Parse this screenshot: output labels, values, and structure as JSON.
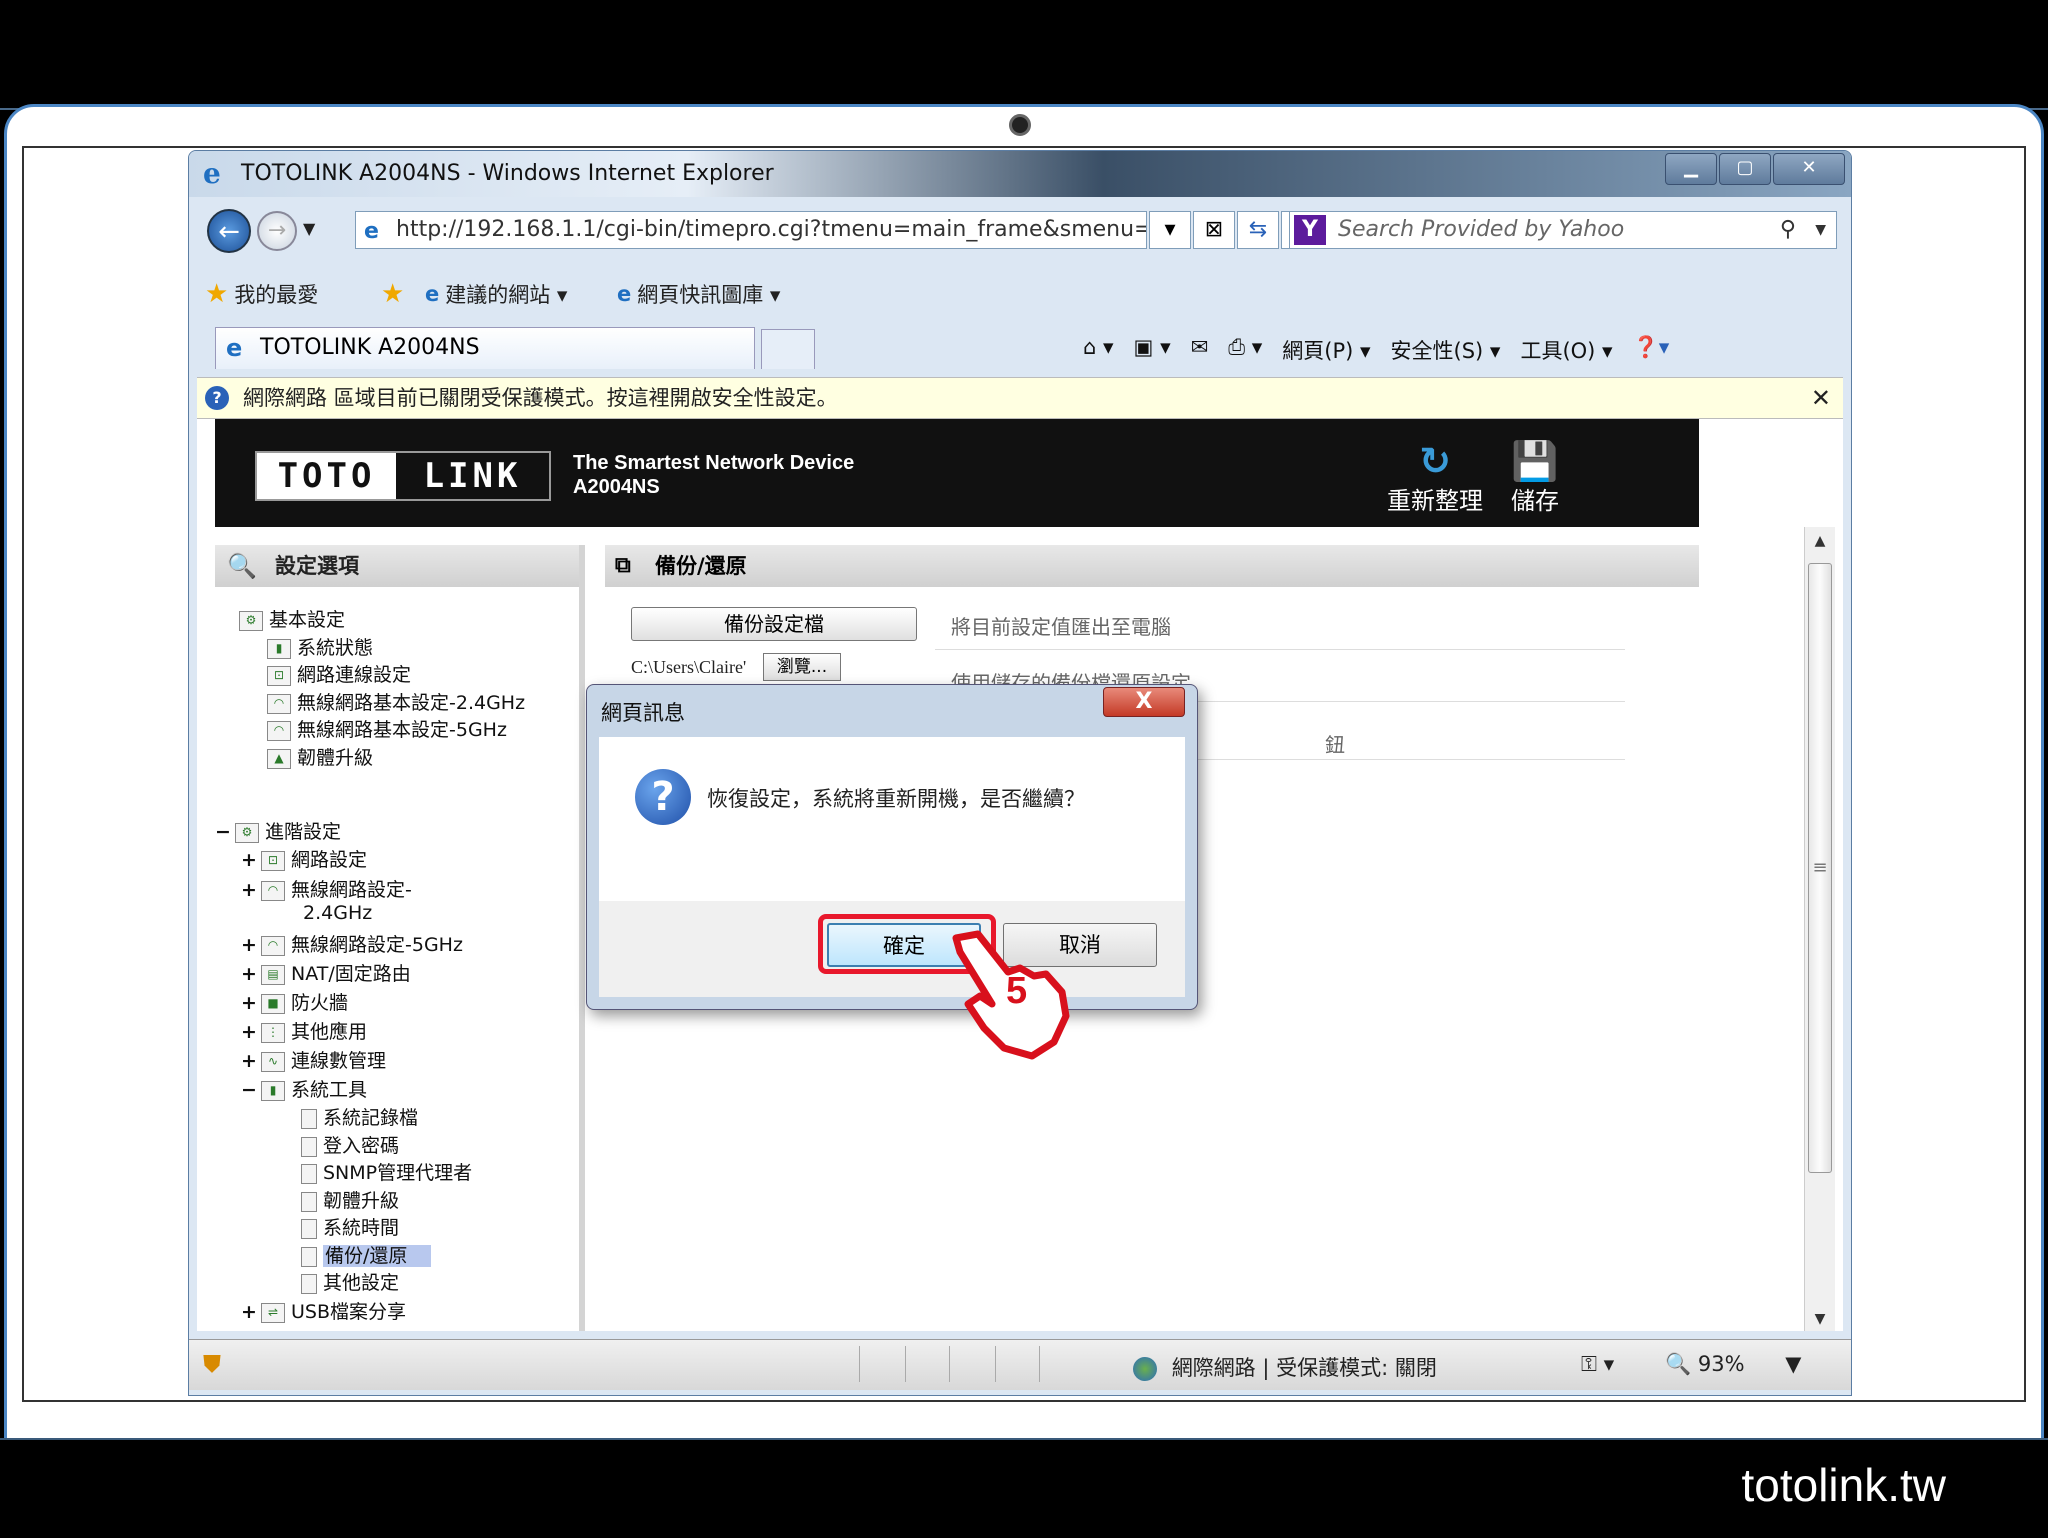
{
  "browser": {
    "title": "TOTOLINK A2004NS - Windows Internet Explorer",
    "address": "http://192.168.1.1/cgi-bin/timepro.cgi?tmenu=main_frame&smenu=",
    "search_placeholder": "Search Provided by Yahoo",
    "favorites": "我的最愛",
    "suggested_sites": "建議的網站 ▾",
    "web_slice_gallery": "網頁快訊圖庫 ▾",
    "tab_title": "TOTOLINK A2004NS",
    "commands": [
      "網頁(P) ▾",
      "安全性(S) ▾",
      "工具(O) ▾"
    ],
    "info_bar": "網際網路 區域目前已關閉受保護模式。按這裡開啟安全性設定。",
    "status_zone": "網際網路 | 受保護模式: 關閉",
    "zoom": "93%"
  },
  "router": {
    "logo_left": "TOTO",
    "logo_right": "LINK",
    "tagline1": "The Smartest Network Device",
    "tagline2": "A2004NS",
    "refresh_label": "重新整理",
    "save_label": "儲存"
  },
  "sidebar": {
    "title": "設定選項",
    "basic": {
      "label": "基本設定",
      "items": [
        "系統狀態",
        "網路連線設定",
        "無線網路基本設定-2.4GHz",
        "無線網路基本設定-5GHz",
        "韌體升級"
      ]
    },
    "advanced": {
      "label": "進階設定",
      "items": [
        "網路設定",
        "無線網路設定-",
        "2.4GHz",
        "無線網路設定-5GHz",
        "NAT/固定路由",
        "防火牆",
        "其他應用",
        "連線數管理",
        "系統工具"
      ]
    },
    "tools": [
      "系統記錄檔",
      "登入密碼",
      "SNMP管理代理者",
      "韌體升級",
      "系統時間",
      "備份/還原",
      "其他設定"
    ],
    "usb": "USB檔案分享"
  },
  "main": {
    "title": "備份/還原",
    "backup_button": "備份設定檔",
    "backup_desc": "將目前設定值匯出至電腦",
    "file_path": "C:\\Users\\Claire'",
    "browse_button": "瀏覽...",
    "restore_desc": "使用儲存的備份檔還原設定",
    "reset_desc_tail": "鈕"
  },
  "dialog": {
    "title": "網頁訊息",
    "close": "X",
    "message": "恢復設定，系統將重新開機，是否繼續？",
    "ok": "確定",
    "cancel": "取消"
  },
  "annotation": {
    "step": "5"
  },
  "footer": {
    "brand": "totolink.tw"
  }
}
